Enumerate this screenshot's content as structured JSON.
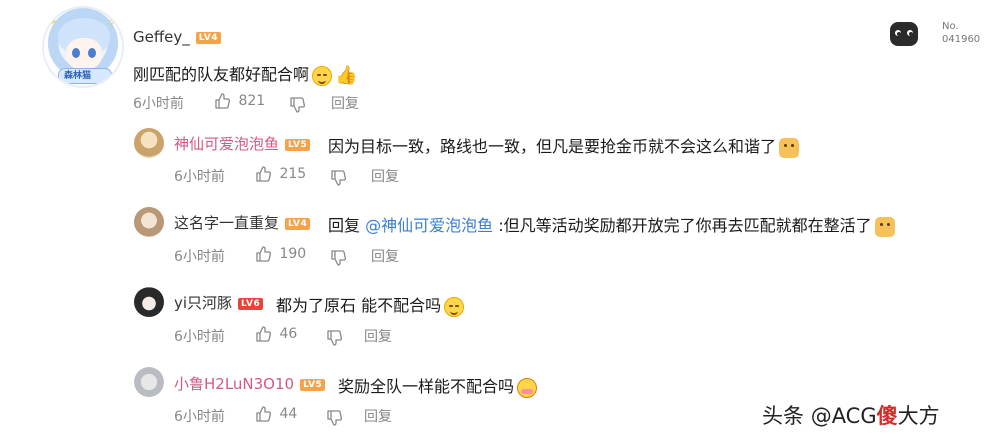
{
  "serial": {
    "label": "No.",
    "number": "041960"
  },
  "main_comment": {
    "username": "Geffey_",
    "level": "LV4",
    "text": "刚匹配的队友都好配合啊",
    "time": "6小时前",
    "likes": "821",
    "reply_label": "回复",
    "avatar_text": "森林猫"
  },
  "replies": [
    {
      "username": "神仙可爱泡泡鱼",
      "level": "LV5",
      "text": "因为目标一致，路线也一致，但凡是要抢金币就不会这么和谐了",
      "time": "6小时前",
      "likes": "215",
      "reply_label": "回复"
    },
    {
      "username": "这名字一直重复",
      "level": "LV4",
      "reply_prefix": "回复",
      "mention": "@神仙可爱泡泡鱼",
      "text": ":但凡等活动奖励都开放完了你再去匹配就都在整活了",
      "time": "6小时前",
      "likes": "190",
      "reply_label": "回复"
    },
    {
      "username": "yi只河豚",
      "level": "LV6",
      "text": "都为了原石  能不配合吗",
      "time": "6小时前",
      "likes": "46",
      "reply_label": "回复"
    },
    {
      "username": "小鲁H2LuN3O10",
      "level": "LV5",
      "text": "奖励全队一样能不配合吗",
      "time": "6小时前",
      "likes": "44",
      "reply_label": "回复"
    }
  ],
  "watermark": {
    "prefix": "头条",
    "handle": "@ACG",
    "suffix": "大方",
    "red_char": "傻"
  },
  "colors": {
    "pink_user": "#d35a82",
    "mention": "#3a7fd4",
    "meta": "#888888"
  }
}
